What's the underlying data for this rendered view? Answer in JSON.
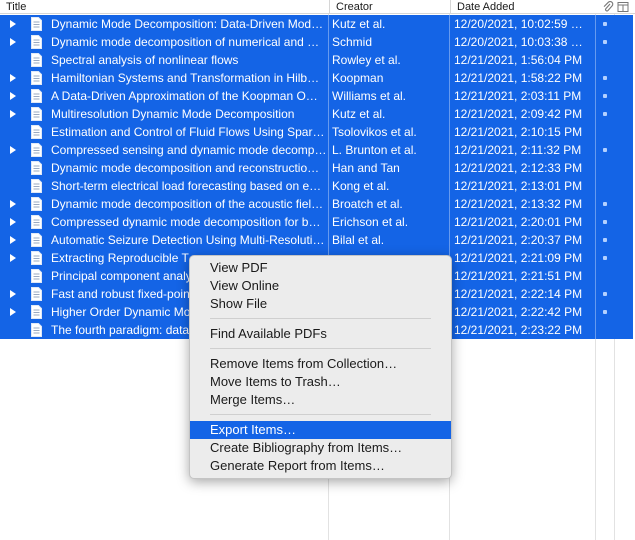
{
  "columns": {
    "title": "Title",
    "creator": "Creator",
    "date_added": "Date Added"
  },
  "rows": [
    {
      "title": "Dynamic Mode Decomposition: Data-Driven Mod…",
      "creator": "Kutz et al.",
      "date": "12/20/2021, 10:02:59 …",
      "expandable": true,
      "attach": true
    },
    {
      "title": "Dynamic mode decomposition of numerical and …",
      "creator": "Schmid",
      "date": "12/20/2021, 10:03:38 …",
      "expandable": true,
      "attach": true
    },
    {
      "title": "Spectral analysis of nonlinear flows",
      "creator": "Rowley et al.",
      "date": "12/21/2021, 1:56:04 PM",
      "expandable": false,
      "attach": false
    },
    {
      "title": "Hamiltonian Systems and Transformation in Hilb…",
      "creator": "Koopman",
      "date": "12/21/2021, 1:58:22 PM",
      "expandable": true,
      "attach": true
    },
    {
      "title": "A Data-Driven Approximation of the Koopman O…",
      "creator": "Williams et al.",
      "date": "12/21/2021, 2:03:11 PM",
      "expandable": true,
      "attach": true
    },
    {
      "title": "Multiresolution Dynamic Mode Decomposition",
      "creator": "Kutz et al.",
      "date": "12/21/2021, 2:09:42 PM",
      "expandable": true,
      "attach": true
    },
    {
      "title": "Estimation and Control of Fluid Flows Using Spar…",
      "creator": "Tsolovikos et al.",
      "date": "12/21/2021, 2:10:15 PM",
      "expandable": false,
      "attach": false
    },
    {
      "title": "Compressed sensing and dynamic mode decomp…",
      "creator": "L. Brunton et al.",
      "date": "12/21/2021, 2:11:32 PM",
      "expandable": true,
      "attach": true
    },
    {
      "title": "Dynamic mode decomposition and reconstructio…",
      "creator": "Han and Tan",
      "date": "12/21/2021, 2:12:33 PM",
      "expandable": false,
      "attach": false
    },
    {
      "title": "Short-term electrical load forecasting based on e…",
      "creator": "Kong et al.",
      "date": "12/21/2021, 2:13:01 PM",
      "expandable": false,
      "attach": false
    },
    {
      "title": "Dynamic mode decomposition of the acoustic fiel…",
      "creator": "Broatch et al.",
      "date": "12/21/2021, 2:13:32 PM",
      "expandable": true,
      "attach": true
    },
    {
      "title": "Compressed dynamic mode decomposition for b…",
      "creator": "Erichson et al.",
      "date": "12/21/2021, 2:20:01 PM",
      "expandable": true,
      "attach": true
    },
    {
      "title": "Automatic Seizure Detection Using Multi-Resoluti…",
      "creator": "Bilal et al.",
      "date": "12/21/2021, 2:20:37 PM",
      "expandable": true,
      "attach": true
    },
    {
      "title": "Extracting Reproducible T",
      "creator": "",
      "date": "12/21/2021, 2:21:09 PM",
      "expandable": true,
      "attach": true
    },
    {
      "title": "Principal component analy",
      "creator": "",
      "date": "12/21/2021, 2:21:51 PM",
      "expandable": false,
      "attach": false
    },
    {
      "title": "Fast and robust fixed-poin",
      "creator": "",
      "date": "12/21/2021, 2:22:14 PM",
      "expandable": true,
      "attach": true
    },
    {
      "title": "Higher Order Dynamic Mo",
      "creator": "",
      "date": "12/21/2021, 2:22:42 PM",
      "expandable": true,
      "attach": true
    },
    {
      "title": "The fourth paradigm: data",
      "creator": "",
      "date": "12/21/2021, 2:23:22 PM",
      "expandable": false,
      "attach": false
    }
  ],
  "context_menu": {
    "view_pdf": "View PDF",
    "view_online": "View Online",
    "show_file": "Show File",
    "find_pdfs": "Find Available PDFs",
    "remove_from_collection": "Remove Items from Collection…",
    "move_to_trash": "Move Items to Trash…",
    "merge_items": "Merge Items…",
    "export_items": "Export Items…",
    "create_bibliography": "Create Bibliography from Items…",
    "generate_report": "Generate Report from Items…"
  },
  "colors": {
    "selection": "#1464e6",
    "menu_bg": "#ececec"
  },
  "icons": {
    "attachment_column": "paperclip-icon",
    "column_picker": "column-picker-icon",
    "row_doc": "document-icon",
    "row_expand": "disclosure-triangle-icon"
  }
}
